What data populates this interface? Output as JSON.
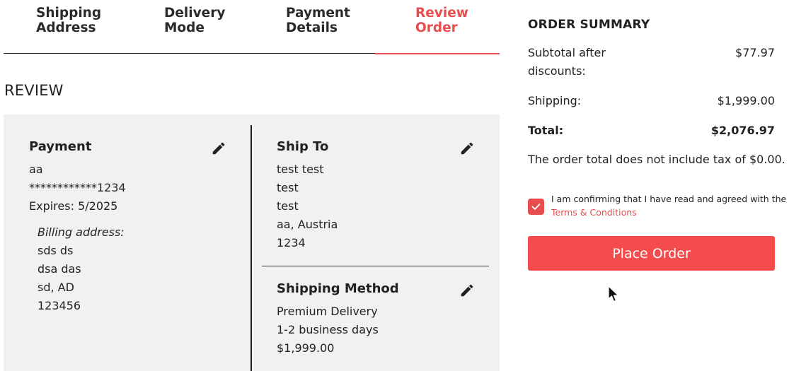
{
  "stepper": {
    "steps": [
      {
        "line1": "Shipping",
        "line2": "Address"
      },
      {
        "line1": "Delivery",
        "line2": "Mode"
      },
      {
        "line1": "Payment",
        "line2": "Details"
      },
      {
        "line1": "Review",
        "line2": "Order"
      }
    ],
    "active_step": 4
  },
  "review": {
    "title": "REVIEW",
    "payment": {
      "title": "Payment",
      "name": "aa",
      "card": "************1234",
      "expires": "Expires: 5/2025",
      "billing_label": "Billing address:",
      "billing_lines": [
        "sds ds",
        "dsa das",
        "sd, AD",
        "123456"
      ],
      "edit_icon": "pencil-icon"
    },
    "ship_to": {
      "title": "Ship To",
      "lines": [
        "test test",
        "test",
        "test",
        "aa, Austria",
        "1234"
      ],
      "edit_icon": "pencil-icon"
    },
    "shipping_method": {
      "title": "Shipping Method",
      "lines": [
        "Premium Delivery",
        "1-2 business days",
        "$1,999.00"
      ],
      "edit_icon": "pencil-icon"
    }
  },
  "summary": {
    "title": "ORDER SUMMARY",
    "subtotal_label_line1": "Subtotal after",
    "subtotal_label_line2": "discounts:",
    "subtotal_value": "$77.97",
    "shipping_label": "Shipping:",
    "shipping_value": "$1,999.00",
    "total_label": "Total:",
    "total_value": "$2,076.97",
    "tax_note": "The order total does not include tax of $0.00.",
    "confirm_text": "I am confirming that I have read and agreed with the",
    "terms_link": "Terms & Conditions",
    "terms_checked": true,
    "place_order_label": "Place Order"
  },
  "colors": {
    "accent": "#e84d4d",
    "button": "#f44c4c",
    "panel_bg": "#f1f1f1",
    "text": "#222222"
  }
}
